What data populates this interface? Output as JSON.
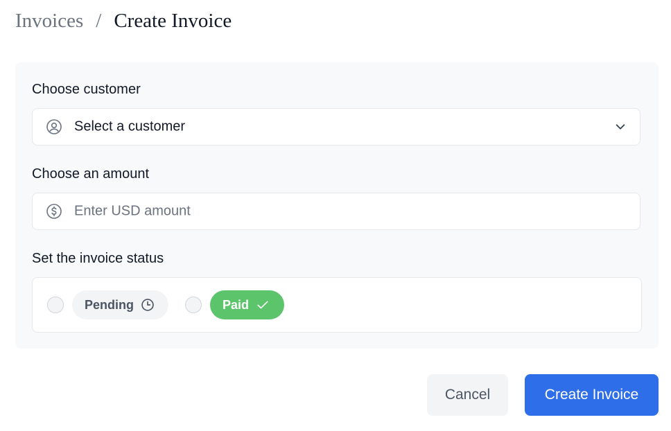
{
  "breadcrumb": {
    "parent": "Invoices",
    "separator": "/",
    "current": "Create Invoice"
  },
  "form": {
    "customer": {
      "label": "Choose customer",
      "value": "Select a customer",
      "icon": "user-circle-icon",
      "dropdown_icon": "chevron-down-icon"
    },
    "amount": {
      "label": "Choose an amount",
      "placeholder": "Enter USD amount",
      "icon": "dollar-circle-icon"
    },
    "status": {
      "label": "Set the invoice status",
      "options": [
        {
          "label": "Pending",
          "icon": "clock-icon",
          "selected": false,
          "color": "#f3f4f6"
        },
        {
          "label": "Paid",
          "icon": "check-icon",
          "selected": false,
          "color": "#5cc46a"
        }
      ]
    }
  },
  "actions": {
    "cancel_label": "Cancel",
    "submit_label": "Create Invoice",
    "submit_color": "#2f6ee9"
  }
}
